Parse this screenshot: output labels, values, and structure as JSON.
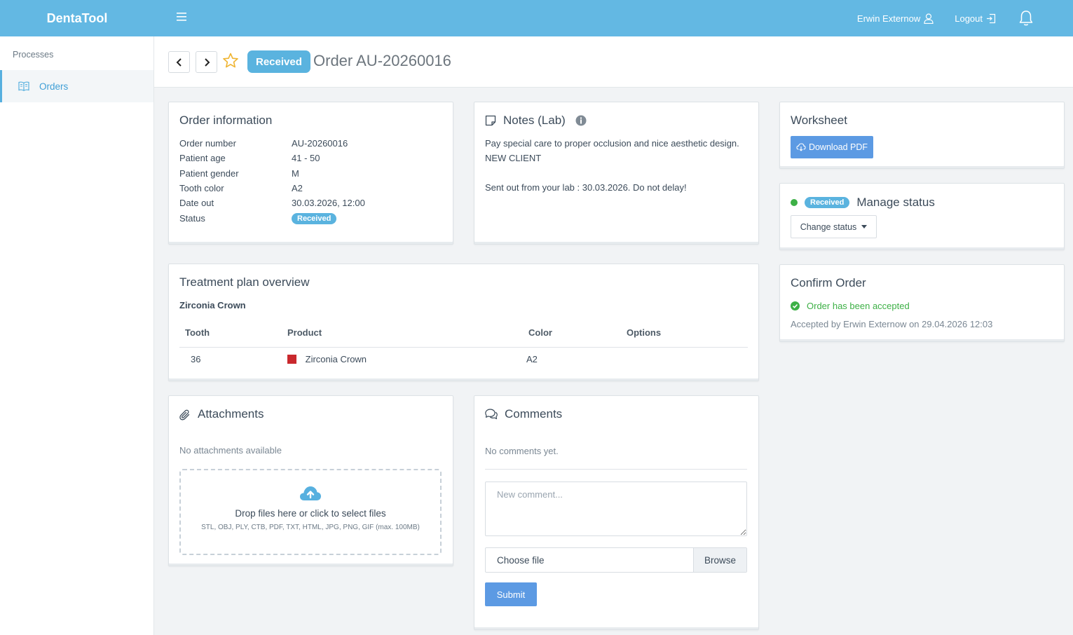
{
  "app": {
    "brand": "DentaTool"
  },
  "topbar": {
    "user_name": "Erwin Externow",
    "logout_label": "Logout"
  },
  "sidebar": {
    "section_label": "Processes",
    "items": [
      {
        "label": "Orders",
        "icon": "book-icon"
      }
    ]
  },
  "header": {
    "status": "Received",
    "title": "Order AU-20260016"
  },
  "order_info": {
    "title": "Order information",
    "rows": [
      {
        "label": "Order number",
        "value": "AU-20260016"
      },
      {
        "label": "Patient age",
        "value": "41 - 50"
      },
      {
        "label": "Patient gender",
        "value": "M"
      },
      {
        "label": "Tooth color",
        "value": "A2"
      },
      {
        "label": "Date out",
        "value": "30.03.2026, 12:00"
      },
      {
        "label": "Status",
        "value": "Received"
      }
    ]
  },
  "notes": {
    "title": "Notes (Lab)",
    "line1": "Pay special care to proper occlusion and nice aesthetic design.",
    "line2": "NEW CLIENT",
    "line3": "Sent out from your lab : 30.03.2026. Do not delay!"
  },
  "worksheet": {
    "title": "Worksheet",
    "download_label": "Download PDF"
  },
  "manage_status": {
    "badge": "Received",
    "title": "Manage status",
    "dot_color": "#3db046",
    "change_label": "Change status"
  },
  "confirm_order": {
    "title": "Confirm Order",
    "accepted_text": "Order has been accepted",
    "accepted_color": "#3db046",
    "accepted_by": "Accepted by Erwin Externow on 29.04.2026 12:03"
  },
  "treatment_plan": {
    "title": "Treatment plan overview",
    "subtitle": "Zirconia Crown",
    "columns": [
      "Tooth",
      "Product",
      "Color",
      "Options"
    ],
    "rows": [
      {
        "tooth": "36",
        "product": "Zirconia Crown",
        "product_color": "#c9282d",
        "color": "A2",
        "options": ""
      }
    ]
  },
  "attachments": {
    "title": "Attachments",
    "empty_text": "No attachments available",
    "drop_title": "Drop files here or click to select files",
    "drop_hint": "STL, OBJ, PLY, CTB, PDF, TXT, HTML, JPG, PNG, GIF (max. 100MB)"
  },
  "comments": {
    "title": "Comments",
    "empty_text": "No comments yet.",
    "placeholder": "New comment...",
    "file_label": "Choose file",
    "browse_label": "Browse",
    "submit_label": "Submit"
  },
  "colors": {
    "topbar": "#63b8e3",
    "accent": "#5ab3df",
    "button": "#5c9ae3"
  }
}
